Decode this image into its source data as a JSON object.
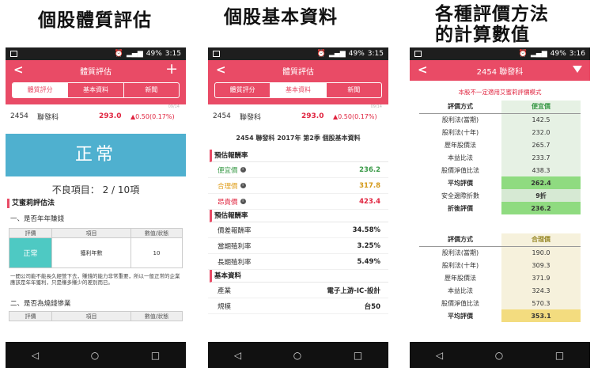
{
  "captions": [
    "個股體質評估",
    "個股基本資料",
    "各種評價方法",
    "的計算數值"
  ],
  "status": {
    "time1": "3:15",
    "time2": "3:15",
    "time3": "3:16",
    "battery": "49%"
  },
  "quote": {
    "code": "2454",
    "name": "聯發科",
    "price": "293.0",
    "change": "▲0.50(0.17%)",
    "stamp": "09/14"
  },
  "tabs": [
    "體質評分",
    "基本資料",
    "新聞"
  ],
  "phone1": {
    "title": "體質評估",
    "status_big": "正常",
    "bad_items": "不良項目： 2 / 10項",
    "section": "艾蜜莉評估法",
    "q1": "一、是否年年賺錢",
    "table_headers": [
      "評價",
      "項目",
      "數值/狀態"
    ],
    "row_result": "正常",
    "row_item": "獲利年數",
    "row_value": "10",
    "paragraph": "一間公司能不能長久經營下去，賺錢的能力非常重要，所以一般正常的企業應該是年年獲利，只是賺多賺少的差別而已。",
    "q2": "二、是否為燒錢慘業",
    "table_headers2": [
      "評價",
      "項目",
      "數值/狀態"
    ]
  },
  "phone2": {
    "title": "體質評估",
    "heading": "2454 聯發科 2017年 第2季 個股基本資料",
    "sec1": "預估報酬率",
    "cheap_label": "便宜價",
    "cheap_value": "236.2",
    "fair_label": "合理價",
    "fair_value": "317.8",
    "exp_label": "昂貴價",
    "exp_value": "423.4",
    "sec2": "預估報酬率",
    "r1_label": "價差報酬率",
    "r1_value": "34.58%",
    "r2_label": "當期殖利率",
    "r2_value": "3.25%",
    "r3_label": "長期殖利率",
    "r3_value": "5.49%",
    "sec3": "基本資料",
    "b1_label": "產業",
    "b1_value": "電子上游-IC-設計",
    "b2_label": "規模",
    "b2_value": "台50"
  },
  "phone3": {
    "title": "2454 聯發科",
    "note": "本股不一定適用艾蜜莉評價模式",
    "t1": {
      "h_method": "評價方式",
      "h_value": "便宜價",
      "rows": [
        {
          "m": "股利法(當期)",
          "v": "142.5"
        },
        {
          "m": "股利法(十年)",
          "v": "232.0"
        },
        {
          "m": "歷年股價法",
          "v": "265.7"
        },
        {
          "m": "本益比法",
          "v": "233.7"
        },
        {
          "m": "股價淨值比法",
          "v": "438.3"
        }
      ],
      "avg_label": "平均評價",
      "avg_value": "262.4",
      "disc_label": "安全邊際折數",
      "disc_value": "9折",
      "final_label": "折後評價",
      "final_value": "236.2"
    },
    "t2": {
      "h_method": "評價方式",
      "h_value": "合理價",
      "rows": [
        {
          "m": "股利法(當期)",
          "v": "190.0"
        },
        {
          "m": "股利法(十年)",
          "v": "309.3"
        },
        {
          "m": "歷年股價法",
          "v": "371.9"
        },
        {
          "m": "本益比法",
          "v": "324.3"
        },
        {
          "m": "股價淨值比法",
          "v": "570.3"
        }
      ],
      "avg_label": "平均評價",
      "avg_value": "353.1"
    }
  },
  "nav": {
    "back": "◁",
    "home": "○",
    "recent": "□"
  }
}
